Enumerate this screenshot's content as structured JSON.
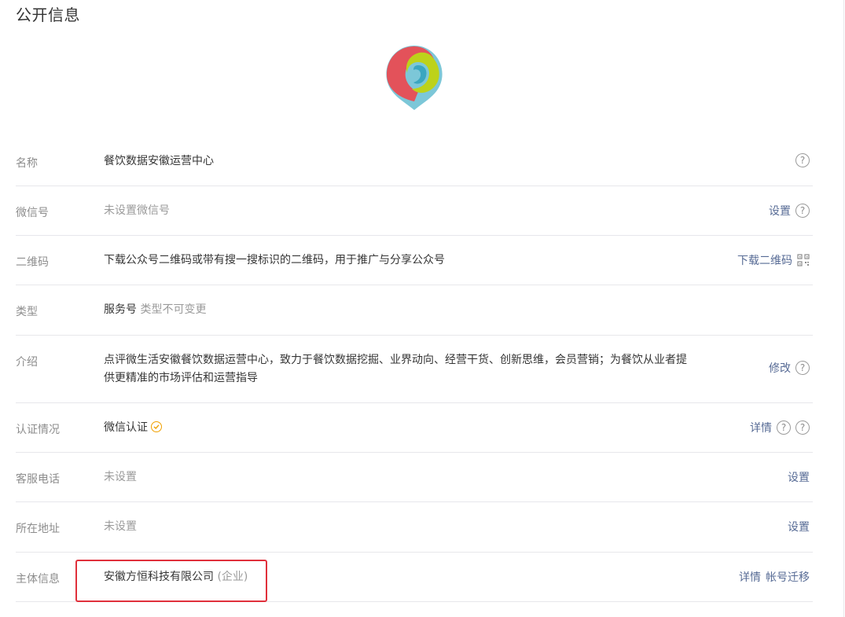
{
  "page": {
    "title": "公开信息"
  },
  "colors": {
    "link": "#576b95",
    "muted": "#9a9a9a",
    "highlight": "#e0303b",
    "verified": "#f0a000"
  },
  "rows": {
    "name": {
      "label": "名称",
      "value": "餐饮数据安徽运营中心"
    },
    "wechat_id": {
      "label": "微信号",
      "value": "未设置微信号",
      "action": "设置"
    },
    "qrcode": {
      "label": "二维码",
      "value": "下载公众号二维码或带有搜一搜标识的二维码，用于推广与分享公众号",
      "action": "下载二维码"
    },
    "type": {
      "label": "类型",
      "value": "服务号",
      "note": "类型不可变更"
    },
    "intro": {
      "label": "介绍",
      "line1": "点评微生活安徽餐饮数据运营中心，致力于餐饮数据挖掘、业界动向、经营干货、创新思维，会员营销；为餐饮从业者提",
      "line2": "供更精准的市场评估和运营指导",
      "action": "修改"
    },
    "verification": {
      "label": "认证情况",
      "value": "微信认证",
      "action": "详情"
    },
    "phone": {
      "label": "客服电话",
      "value": "未设置",
      "action": "设置"
    },
    "address": {
      "label": "所在地址",
      "value": "未设置",
      "action": "设置"
    },
    "entity": {
      "label": "主体信息",
      "value": "安徽方恒科技有限公司",
      "note": "(企业)",
      "action_details": "详情",
      "action_migrate": "帐号迁移"
    }
  },
  "icons": {
    "help": "question-circle-icon",
    "qr": "qr-code-icon",
    "verified": "check-circle-icon"
  }
}
